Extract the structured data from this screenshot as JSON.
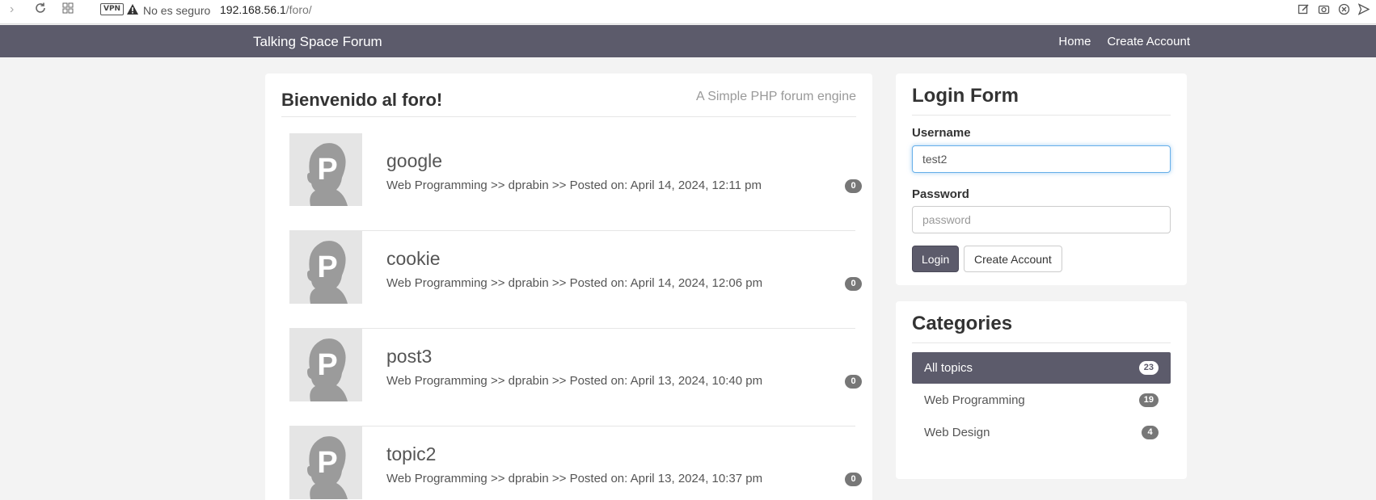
{
  "browser": {
    "vpn_label": "VPN",
    "security_label": "No es seguro",
    "url_host": "192.168.56.1",
    "url_path": "/foro/"
  },
  "navbar": {
    "brand": "Talking Space Forum",
    "links": [
      "Home",
      "Create Account"
    ]
  },
  "main": {
    "welcome": "Bienvenido al foro!",
    "tagline": "A Simple PHP forum engine",
    "avatar_letter": "P",
    "topics": [
      {
        "title": "google",
        "category": "Web Programming",
        "sep1": ">>",
        "author": "dprabin",
        "sep2": ">>",
        "posted": "Posted on: April 14, 2024, 12:11 pm",
        "replies": "0"
      },
      {
        "title": "cookie",
        "category": "Web Programming",
        "sep1": ">>",
        "author": "dprabin",
        "sep2": ">>",
        "posted": "Posted on: April 14, 2024, 12:06 pm",
        "replies": "0"
      },
      {
        "title": "post3",
        "category": "Web Programming",
        "sep1": ">>",
        "author": "dprabin",
        "sep2": ">>",
        "posted": "Posted on: April 13, 2024, 10:40 pm",
        "replies": "0"
      },
      {
        "title": "topic2",
        "category": "Web Programming",
        "sep1": ">>",
        "author": "dprabin",
        "sep2": ">>",
        "posted": "Posted on: April 13, 2024, 10:37 pm",
        "replies": "0"
      }
    ]
  },
  "login": {
    "title": "Login Form",
    "username_label": "Username",
    "username_value": "test2",
    "password_label": "Password",
    "password_placeholder": "password",
    "login_button": "Login",
    "create_button": "Create Account"
  },
  "categories": {
    "title": "Categories",
    "items": [
      {
        "label": "All topics",
        "count": "23",
        "active": true
      },
      {
        "label": "Web Programming",
        "count": "19",
        "active": false
      },
      {
        "label": "Web Design",
        "count": "4",
        "active": false
      }
    ]
  },
  "colors": {
    "navbar": "#5c5b6b",
    "badge": "#777777",
    "page_bg": "#f3f3f3"
  }
}
